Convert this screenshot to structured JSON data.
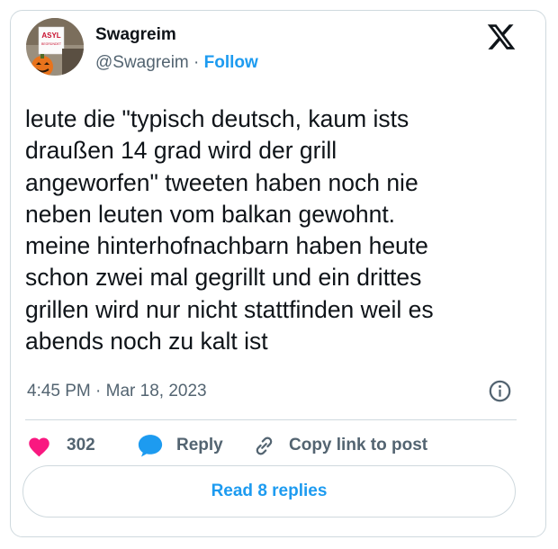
{
  "author": {
    "name": "Swagreim",
    "handle": "@Swagreim",
    "separator": "·",
    "follow_label": "Follow",
    "avatar_sign_text": "ASYL",
    "avatar_sign_subtext": "BEGRÜNDET"
  },
  "tweet": {
    "text": "leute die \"typisch deutsch, kaum ists\ndraußen 14 grad wird der grill\nangeworfen\" tweeten haben noch nie\nneben leuten vom balkan gewohnt.\nmeine hinterhofnachbarn haben heute\nschon zwei mal gegrillt und ein drittes\ngrillen wird nur nicht stattfinden weil es\nabends noch zu kalt ist",
    "timestamp": "4:45 PM · Mar 18, 2023"
  },
  "actions": {
    "like_count": "302",
    "reply_label": "Reply",
    "copy_link_label": "Copy link to post"
  },
  "footer": {
    "read_replies_label": "Read 8 replies"
  },
  "icons": {
    "x_logo": "x-logo-icon",
    "info": "info-icon",
    "like": "heart-icon",
    "reply": "speech-bubble-icon",
    "copy_link": "link-icon"
  },
  "colors": {
    "accent": "#1d9bf0",
    "like": "#f91880",
    "text_primary": "#0f1419",
    "text_secondary": "#536471",
    "border": "#cfd9de"
  }
}
